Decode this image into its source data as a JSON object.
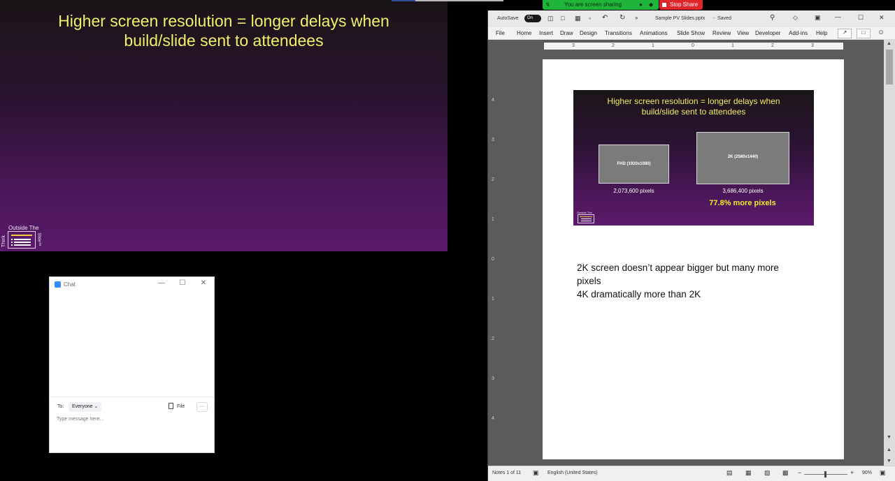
{
  "presenter_slide": {
    "title_line1": "Higher screen resolution = longer delays when",
    "title_line2": "build/slide sent to attendees",
    "logo": {
      "top": "Outside The",
      "left": "Think",
      "right": "Slide™"
    }
  },
  "share_bar": {
    "status": "You are screen sharing",
    "stop_label": "Stop Share",
    "colors": {
      "status_bg": "#1fb43a",
      "stop_bg": "#e0262b"
    }
  },
  "chat": {
    "title": "Chat",
    "to_label": "To:",
    "recipient": "Everyone",
    "file_label": "File",
    "more_label": "···",
    "placeholder": "Type message here..."
  },
  "powerpoint": {
    "autosave_label": "AutoSave",
    "autosave_state": "On",
    "file_title": "Sample PV Slides.pptx",
    "save_status": "Saved",
    "menu": [
      "File",
      "Home",
      "Insert",
      "Draw",
      "Design",
      "Transitions",
      "Animations",
      "Slide Show",
      "Review",
      "View",
      "Developer",
      "Add-ins",
      "Help"
    ],
    "ruler_ticks": [
      "3",
      "2",
      "1",
      "0",
      "1",
      "2",
      "3"
    ],
    "vruler_ticks": [
      "4",
      "3",
      "2",
      "1",
      "0",
      "1",
      "2",
      "3",
      "4"
    ],
    "mini_slide": {
      "title_line1": "Higher screen resolution = longer delays when",
      "title_line2": "build/slide sent to attendees",
      "fhd_label": "FHD (1920x1080)",
      "fhd_pixels": "2,073,600 pixels",
      "qhd_label": "2K (2560x1440)",
      "qhd_pixels": "3,686,400 pixels",
      "more_pixels": "77.8% more pixels",
      "logo_text": "Outside The"
    },
    "notes_lines": [
      "2K screen doesn’t appear bigger but many more",
      "pixels",
      "4K dramatically more than 2K"
    ],
    "status": {
      "notes_count": "Notes 1 of 11",
      "language": "English (United States)",
      "zoom": "90%"
    }
  }
}
